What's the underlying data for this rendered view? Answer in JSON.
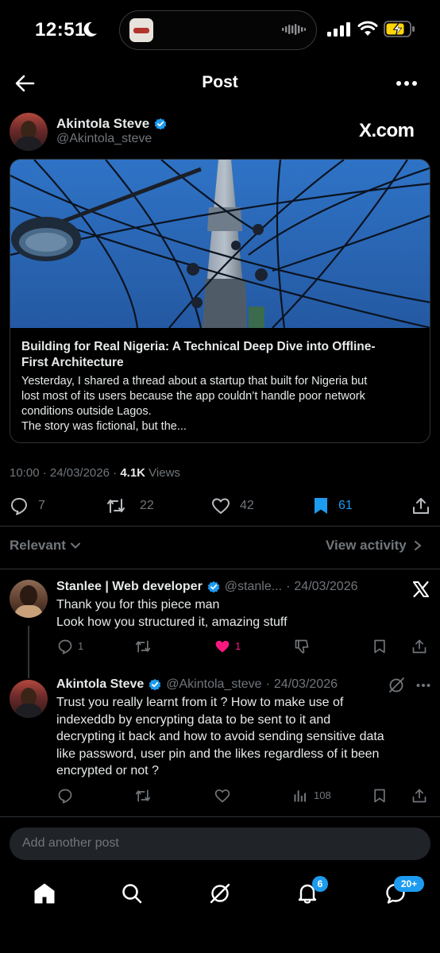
{
  "status_bar": {
    "time": "12:51"
  },
  "header": {
    "title": "Post"
  },
  "post": {
    "author_name": "Akintola Steve",
    "author_handle": "@Akintola_steve",
    "source_label": "X.com",
    "article": {
      "title_lines": [
        "Building for Real Nigeria: A Technical Deep Dive into Offline-",
        "First Architecture"
      ],
      "body_lines": [
        "Yesterday, I shared a thread about a startup that built for Nigeria but",
        "lost most of its users because the app couldn’t handle poor network",
        "conditions outside Lagos.",
        "The story was fictional, but the..."
      ]
    },
    "time": "10:00",
    "date": "24/03/2026",
    "views_count": "4.1K",
    "views_label": "Views",
    "stats": {
      "replies": "7",
      "reposts": "22",
      "likes": "42",
      "bookmarks": "61"
    }
  },
  "filters": {
    "sort_label": "Relevant",
    "view_activity": "View activity"
  },
  "replies": [
    {
      "name": "Stanlee | Web developer",
      "handle": "@stanle...",
      "date": "24/03/2026",
      "lines": [
        "Thank you for this piece man",
        "Look how you structured it, amazing stuff"
      ],
      "reply_count": "1",
      "like_count": "1"
    },
    {
      "name": "Akintola Steve",
      "handle": "@Akintola_steve",
      "date": "24/03/2026",
      "lines": [
        "Trust you really learnt from it ? How to make use of",
        "indexeddb by encrypting data to be sent to it and",
        "decrypting it back and how to avoid sending sensitive data",
        "like password, user pin and the likes regardless of it been",
        "encrypted or not ?"
      ],
      "views_count": "108"
    }
  ],
  "composer": {
    "placeholder": "Add another post"
  },
  "bottom_nav": {
    "notifications_badge": "6",
    "messages_badge": "20+"
  },
  "colors": {
    "accent": "#1d9bf0",
    "like": "#f91880",
    "background": "#000000",
    "muted": "#71767b"
  }
}
